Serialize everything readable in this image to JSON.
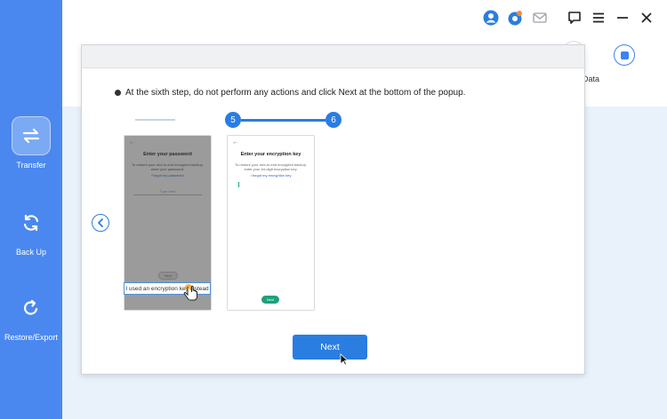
{
  "sidebar": {
    "items": [
      {
        "label": "Transfer",
        "icon": "transfer-icon",
        "active": true
      },
      {
        "label": "Back Up",
        "icon": "backup-icon",
        "active": false
      },
      {
        "label": "Restore/Export",
        "icon": "restore-icon",
        "active": false
      }
    ]
  },
  "titlebar": {
    "icons": [
      "account-icon",
      "update-icon",
      "mail-icon",
      "feedback-icon",
      "menu-icon",
      "minimize-icon",
      "close-icon"
    ]
  },
  "background": {
    "data_label": "Data"
  },
  "modal": {
    "instruction": "At the sixth step, do not perform any actions and click Next at the bottom of the popup.",
    "steps": [
      "5",
      "6"
    ],
    "phone_left": {
      "title": "Enter your password",
      "description": "To restore your end-to-end encrypted backup, enter your password.",
      "link": "Forgot my password",
      "field_placeholder": "Type here",
      "next_label": "Next",
      "highlight_button": "I used an encryption key instead"
    },
    "phone_right": {
      "title": "Enter your encryption key",
      "description": "To restore your end-to-end encrypted backup, enter your 64-digit encryption key.",
      "link": "I forgot my encryption key",
      "next_label": "Next"
    },
    "next_button": "Next"
  },
  "colors": {
    "sidebar": "#4a88f0",
    "accent": "#2a7de1",
    "whatsapp_green": "#1ea07a"
  }
}
